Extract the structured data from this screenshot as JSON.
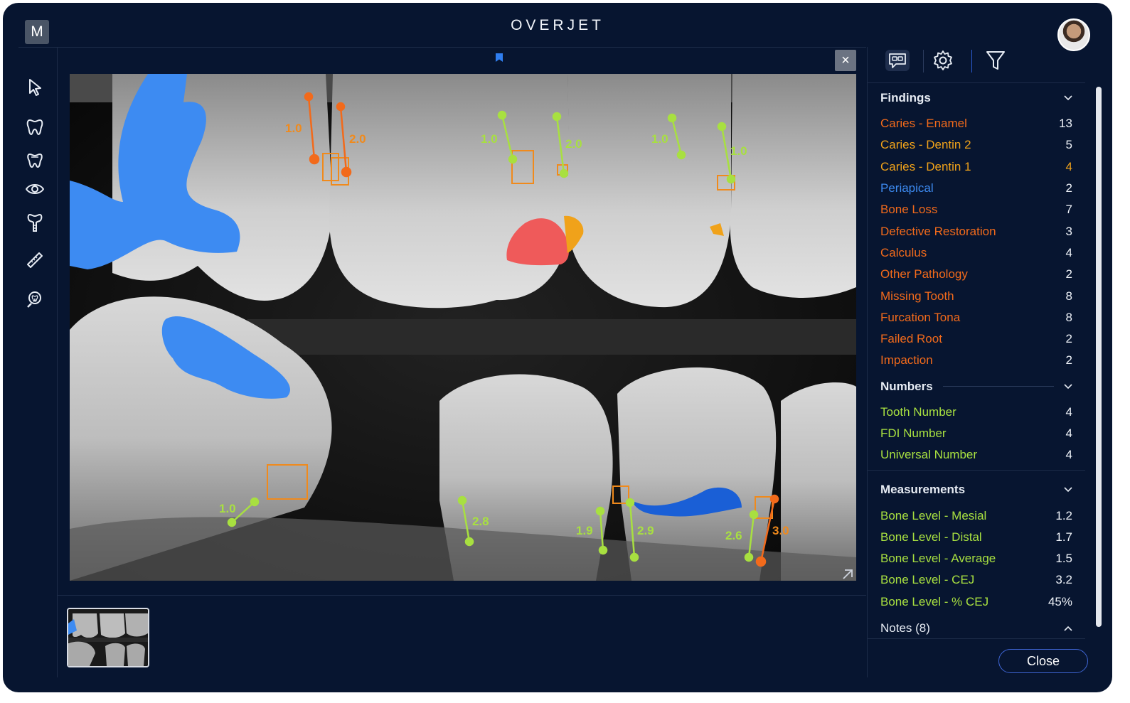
{
  "app": {
    "logo": "M",
    "title": "OVERJET"
  },
  "viewer": {
    "close_glyph": "×"
  },
  "measure_labels": {
    "upper": [
      "1.0",
      "2.0",
      "1.0",
      "2.0",
      "1.0",
      "1.0"
    ],
    "lower": [
      "1.0",
      "2.8",
      "1.9",
      "2.9",
      "2.6",
      "3.0"
    ]
  },
  "panel": {
    "findings": {
      "title": "Findings",
      "items": [
        {
          "label": "Caries - Enamel",
          "value": "13",
          "color": "#f26a1b"
        },
        {
          "label": "Caries - Dentin 2",
          "value": "5",
          "color": "#f0a21a"
        },
        {
          "label": "Caries - Dentin 1",
          "value": "4",
          "color": "#f0a21a",
          "value_color": "#f0a21a"
        },
        {
          "label": "Periapical",
          "value": "2",
          "color": "#3d8bf2"
        },
        {
          "label": "Bone Loss",
          "value": "7",
          "color": "#f26a1b"
        },
        {
          "label": "Defective Restoration",
          "value": "3",
          "color": "#f26a1b"
        },
        {
          "label": "Calculus",
          "value": "4",
          "color": "#f26a1b"
        },
        {
          "label": "Other Pathology",
          "value": "2",
          "color": "#f26a1b"
        },
        {
          "label": "Missing Tooth",
          "value": "8",
          "color": "#f26a1b"
        },
        {
          "label": "Furcation Tona",
          "value": "8",
          "color": "#f26a1b"
        },
        {
          "label": "Failed Root",
          "value": "2",
          "color": "#f26a1b"
        },
        {
          "label": "Impaction",
          "value": "2",
          "color": "#f26a1b"
        }
      ]
    },
    "numbers": {
      "title": "Numbers",
      "items": [
        {
          "label": "Tooth Number",
          "value": "4",
          "color": "#a8e040"
        },
        {
          "label": "FDI Number",
          "value": "4",
          "color": "#a8e040"
        },
        {
          "label": "Universal Number",
          "value": "4",
          "color": "#a8e040"
        }
      ]
    },
    "measurements": {
      "title": "Measurements",
      "items": [
        {
          "label": "Bone Level - Mesial",
          "value": "1.2",
          "color": "#a8e040"
        },
        {
          "label": "Bone Level - Distal",
          "value": "1.7",
          "color": "#a8e040"
        },
        {
          "label": "Bone Level - Average",
          "value": "1.5",
          "color": "#a8e040"
        },
        {
          "label": "Bone Level - CEJ",
          "value": "3.2",
          "color": "#a8e040"
        },
        {
          "label": "Bone Level - % CEJ",
          "value": "45%",
          "color": "#a8e040"
        }
      ]
    },
    "notes": {
      "title": "Notes (8)"
    }
  },
  "close_button": "Close",
  "icons": [
    "pointer-icon",
    "tooth-icon",
    "tooth-outline-icon",
    "eye-icon",
    "implant-icon",
    "ruler-icon",
    "tooth-search-icon",
    "comment-icon",
    "settings-icon",
    "filter-icon",
    "bookmark-icon",
    "expand-icon"
  ]
}
